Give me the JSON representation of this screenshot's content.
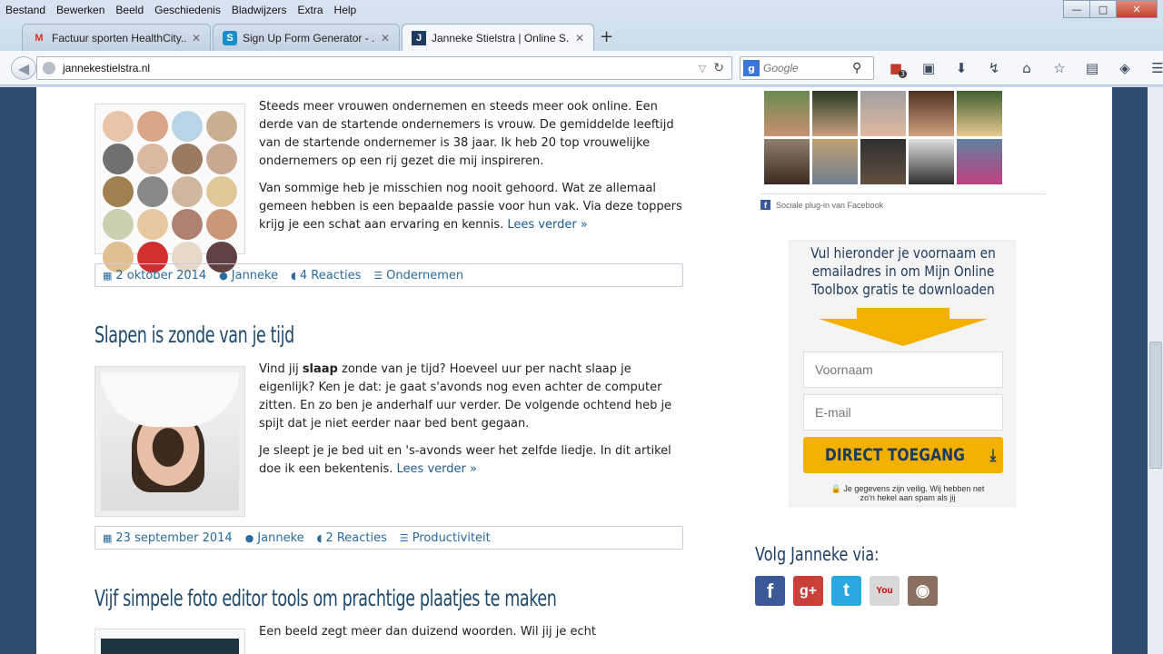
{
  "menu": [
    "Bestand",
    "Bewerken",
    "Beeld",
    "Geschiedenis",
    "Bladwijzers",
    "Extra",
    "Help"
  ],
  "menu_underline": [
    "B",
    "w",
    "e",
    "G",
    "l",
    "x",
    "H"
  ],
  "window": {
    "minimize": "—",
    "maximize": "□",
    "close": "✕"
  },
  "tabs": [
    {
      "title": "Factuur sporten HealthCity...",
      "favicon": "gmail-icon",
      "glyph": "M",
      "color": "#d93025"
    },
    {
      "title": "Sign Up Form Generator - ...",
      "favicon": "form-generator-icon",
      "glyph": "S",
      "color": "#1a8ec8"
    },
    {
      "title": "Janneke Stielstra | Online S...",
      "favicon": "site-icon",
      "glyph": "J",
      "color": "#1e3a5e"
    }
  ],
  "new_tab": "+",
  "address": {
    "url": "jannekestielstra.nl"
  },
  "search": {
    "engine": "g",
    "placeholder": "Google"
  },
  "badge_count": "3",
  "posts": [
    {
      "paragraphs": [
        "Steeds meer vrouwen ondernemen en steeds meer ook online. Een derde van de startende ondernemers is vrouw. De gemiddelde leeftijd van de startende ondernemer is 38 jaar. Ik heb 20 top vrouwelijke ondernemers op een rij gezet die mij inspireren.",
        "Van sommige heb je misschien nog nooit gehoord. Wat ze allemaal gemeen hebben is een bepaalde passie voor hun vak. Via deze toppers krijg je een schat aan ervaring en kennis."
      ],
      "read_more": "Lees verder »",
      "meta": {
        "date": "2 oktober 2014",
        "author": "Janneke",
        "comments": "4 Reacties",
        "category": "Ondernemen"
      }
    },
    {
      "title": "Slapen is zonde van je tijd",
      "p1_before": "Vind jij ",
      "p1_bold": "slaap",
      "p1_after": " zonde van je tijd? Hoeveel uur per nacht slaap je eigenlijk? Ken je dat: je gaat s'avonds nog even achter de computer zitten. En zo ben je anderhalf uur verder.  De volgende ochtend heb je spijt dat je niet eerder naar bed bent gegaan.",
      "p2": "Je sleept je je bed uit en 's-avonds weer het zelfde liedje. In dit artikel doe ik een bekentenis.",
      "read_more": "Lees verder »",
      "meta": {
        "date": "23 september 2014",
        "author": "Janneke",
        "comments": "2 Reacties",
        "category": "Productiviteit"
      }
    },
    {
      "title": "Vijf simpele foto editor tools om prachtige plaatjes te maken",
      "p1": "Een beeld zegt meer dan duizend woorden. Wil jij je echt"
    }
  ],
  "sidebar": {
    "fb_plugin": "Sociale plug-in van Facebook",
    "optin": {
      "headline": "Vul hieronder je voornaam en emailadres in om Mijn Online Toolbox gratis te downloaden",
      "firstname_placeholder": "Voornaam",
      "email_placeholder": "E-mail",
      "button": "DIRECT TOEGANG",
      "privacy": "Je gegevens zijn veilig. Wij hebben net zo'n hekel aan spam als jij"
    },
    "follow_title": "Volg Janneke via:",
    "social": [
      {
        "name": "facebook-icon",
        "glyph": "f",
        "color": "#3b5998"
      },
      {
        "name": "googleplus-icon",
        "glyph": "g+",
        "color": "#c9403a"
      },
      {
        "name": "twitter-icon",
        "glyph": "t",
        "color": "#2aa9e0"
      },
      {
        "name": "youtube-icon",
        "glyph": "You",
        "color": "#b8b8b8"
      },
      {
        "name": "instagram-icon",
        "glyph": "◉",
        "color": "#8a7060"
      }
    ]
  },
  "colors": {
    "accent": "#f2b100",
    "link": "#1e5a8e",
    "title": "#1e4a6e",
    "frame": "#2f4c6e"
  }
}
